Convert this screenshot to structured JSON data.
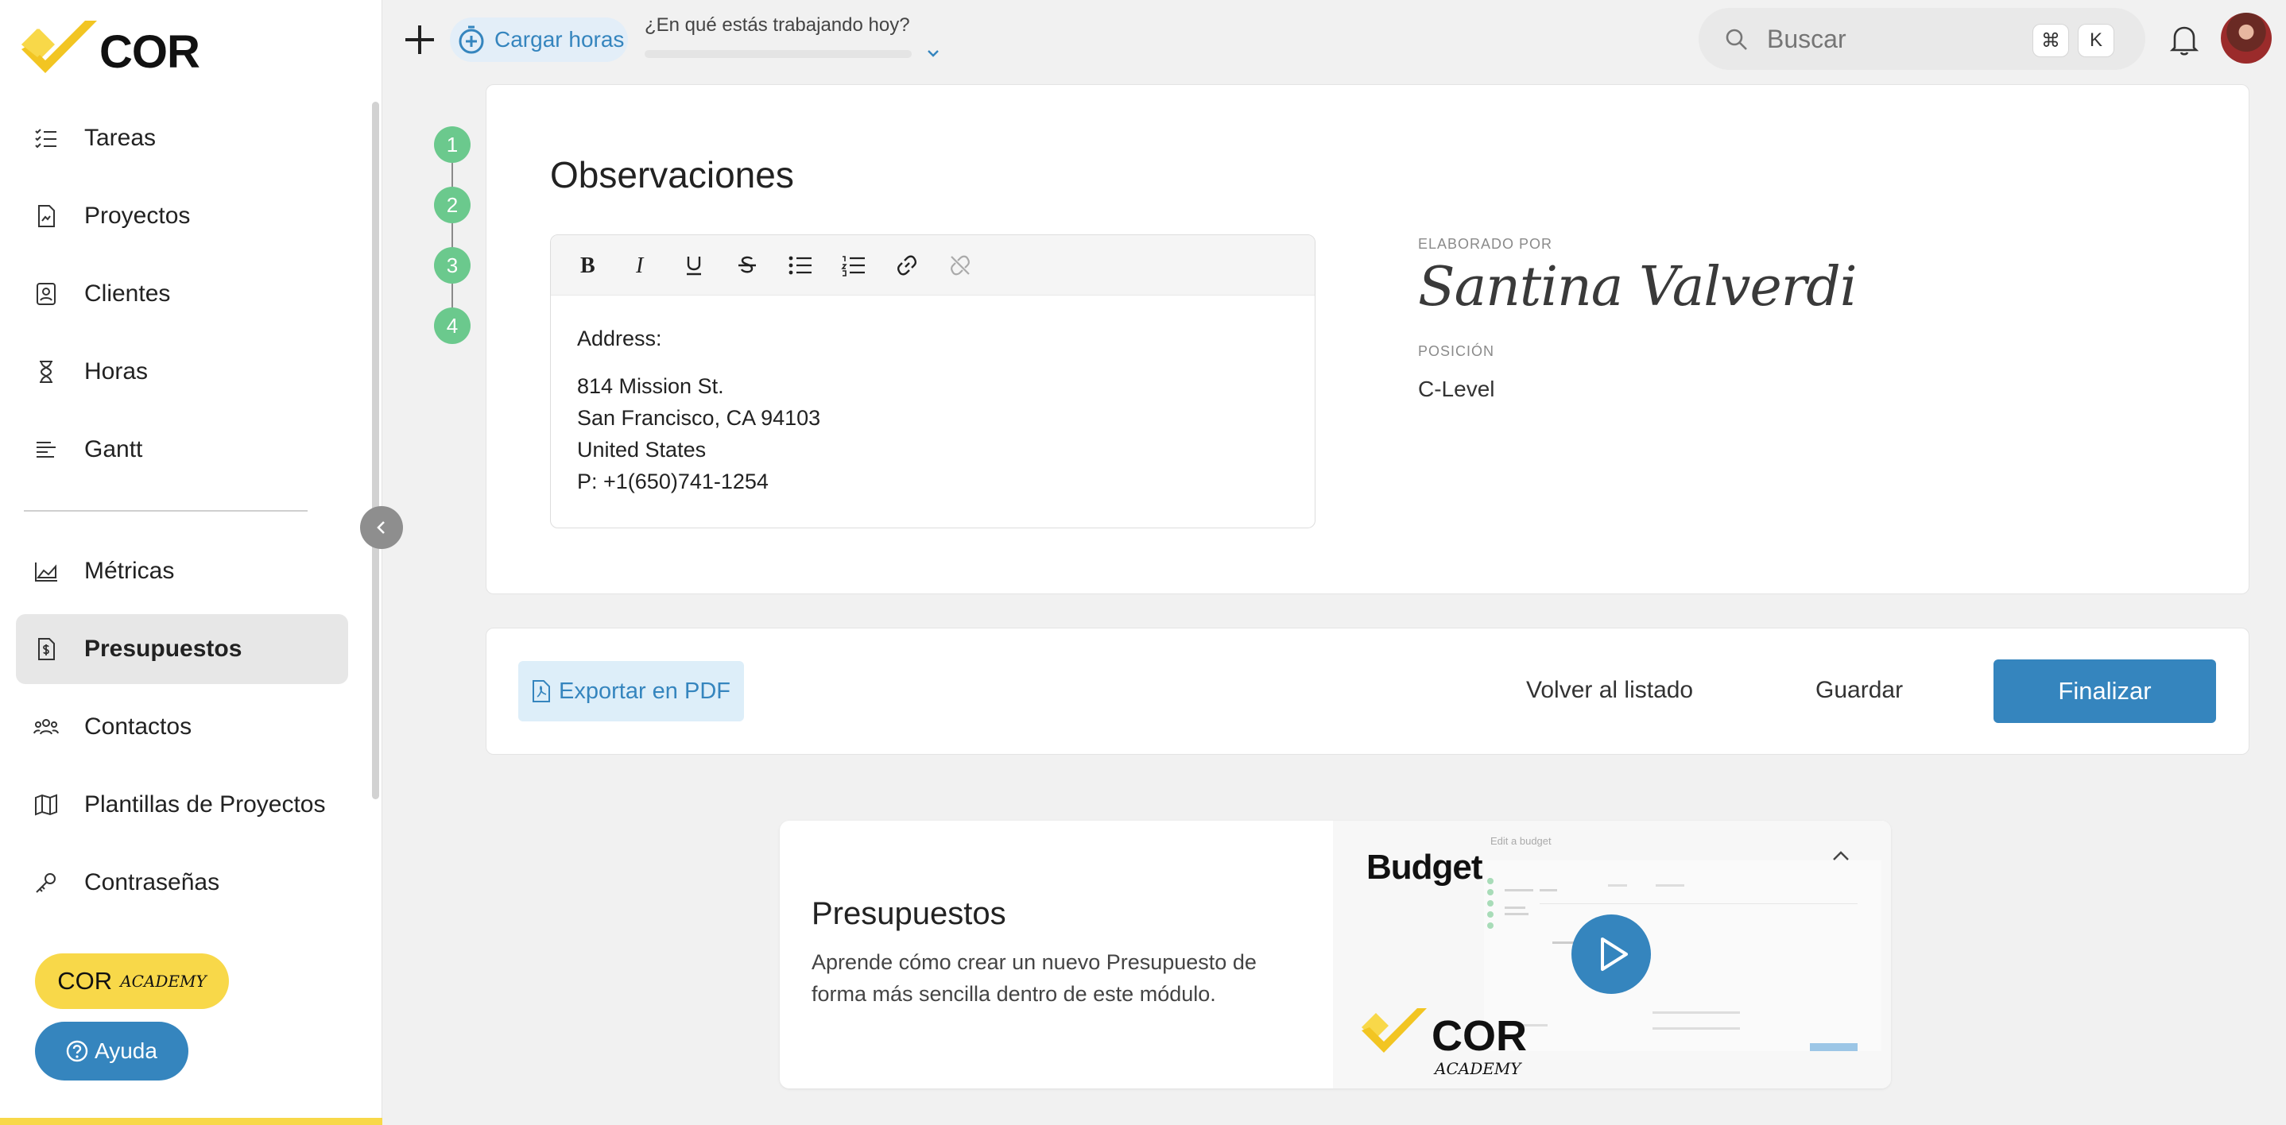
{
  "brand": {
    "logo_text": "COR",
    "accent": "#f8d849",
    "primary": "#3585be",
    "step_color": "#6bc98d"
  },
  "sidebar": {
    "items": [
      {
        "label": "Tareas",
        "icon": "tasks-icon"
      },
      {
        "label": "Proyectos",
        "icon": "project-file-icon"
      },
      {
        "label": "Clientes",
        "icon": "client-card-icon"
      },
      {
        "label": "Horas",
        "icon": "hourglass-icon"
      },
      {
        "label": "Gantt",
        "icon": "gantt-icon"
      },
      {
        "label": "Métricas",
        "icon": "area-chart-icon"
      },
      {
        "label": "Presupuestos",
        "icon": "budget-file-icon",
        "active": true
      },
      {
        "label": "Contactos",
        "icon": "contacts-icon"
      },
      {
        "label": "Plantillas de Proyectos",
        "icon": "map-icon"
      },
      {
        "label": "Contraseñas",
        "icon": "key-icon"
      }
    ],
    "academy_label": "COR",
    "academy_sub": "ACADEMY",
    "help_label": "Ayuda"
  },
  "topbar": {
    "cargar_label": "Cargar horas",
    "question": "¿En qué estás trabajando hoy?",
    "search_placeholder": "Buscar",
    "shortcut_cmd": "⌘",
    "shortcut_key": "K"
  },
  "steps": [
    "1",
    "2",
    "3",
    "4"
  ],
  "observaciones": {
    "title": "Observaciones",
    "toolbar": [
      "bold-icon",
      "italic-icon",
      "underline-icon",
      "strikethrough-icon",
      "bullet-list-icon",
      "numbered-list-icon",
      "link-icon",
      "unlink-icon"
    ],
    "address_label": "Address:",
    "address_lines": [
      "814 Mission St.",
      "San Francisco, CA 94103",
      "United States",
      "P: +1(650)741-1254"
    ],
    "elaborado_label": "ELABORADO POR",
    "signature": "Santina Valverdi",
    "posicion_label": "POSICIÓN",
    "posicion_value": "C-Level"
  },
  "actions": {
    "export_label": "Exportar en PDF",
    "volver_label": "Volver al listado",
    "guardar_label": "Guardar",
    "finalizar_label": "Finalizar"
  },
  "promo": {
    "title": "Presupuestos",
    "description": "Aprende cómo crear un nuevo Presupuesto de forma más sencilla dentro de este módulo.",
    "thumb_title": "Budget",
    "thumb_edit": "Edit a budget",
    "thumb_logo": "COR",
    "thumb_sub": "ACADEMY"
  }
}
